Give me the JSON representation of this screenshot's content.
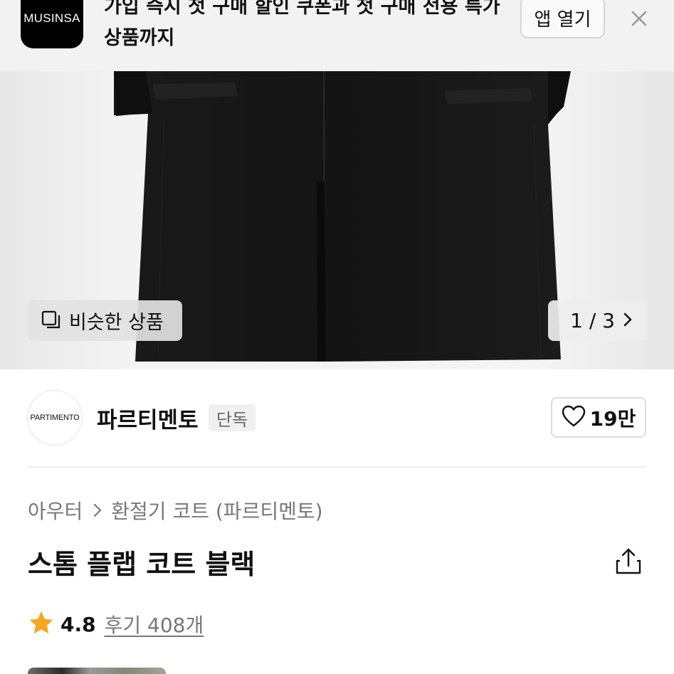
{
  "app_banner": {
    "logo_text": "MUSINSA",
    "text": "가입 즉시 첫 구매 할인 쿠폰과 첫 구매 전용 특가 상품까지",
    "open_app_label": "앱 열기",
    "close_icon": "close-icon"
  },
  "hero": {
    "similar_products_label": "비슷한 상품",
    "similar_icon": "copy-icon",
    "pager_text": "1 / 3",
    "pager_icon": "chevron-right-icon"
  },
  "brand": {
    "logo_text": "PARTIMENTO",
    "name": "파르티멘토",
    "badge": "단독",
    "likes": "19만",
    "like_icon": "heart-icon"
  },
  "product": {
    "breadcrumb": [
      "아우터",
      "환절기 코트 (파르티멘토)"
    ],
    "breadcrumb_sep_icon": "chevron-right-icon",
    "title": "스톰 플랩 코트 블랙",
    "share_icon": "share-icon"
  },
  "rating": {
    "star_icon": "star-icon",
    "star_color": "#F5A623",
    "score": "4.8",
    "reviews_label": "후기 408개"
  }
}
